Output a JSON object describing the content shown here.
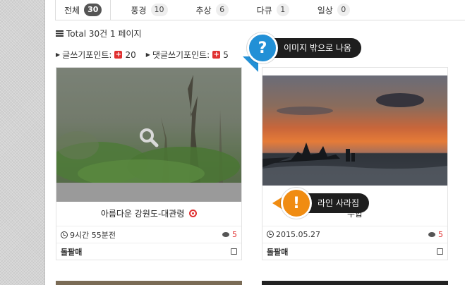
{
  "tabs": [
    {
      "label": "전체",
      "count": "30"
    },
    {
      "label": "풍경",
      "count": "10"
    },
    {
      "label": "추상",
      "count": "6"
    },
    {
      "label": "다큐",
      "count": "1"
    },
    {
      "label": "일상",
      "count": "0"
    }
  ],
  "total": {
    "text": "Total 30건 1 페이지"
  },
  "points": {
    "write_label": "글쓰기포인트:",
    "write_value": "20",
    "comment_label": "댓글쓰기포인트:",
    "comment_value": "5"
  },
  "cards": [
    {
      "title": "아름다운 강원도-대관령",
      "time": "9시간 55분전",
      "comments": "5",
      "author": "돌팔매"
    },
    {
      "title": "수합",
      "time": "2015.05.27",
      "comments": "5",
      "author": "돌팔매"
    }
  ],
  "callouts": {
    "blue": {
      "symbol": "?",
      "text": "이미지 밖으로 나옴",
      "color": "#2290d6"
    },
    "orange": {
      "symbol": "!",
      "text": "라인 사라짐",
      "color": "#f08c12"
    }
  }
}
